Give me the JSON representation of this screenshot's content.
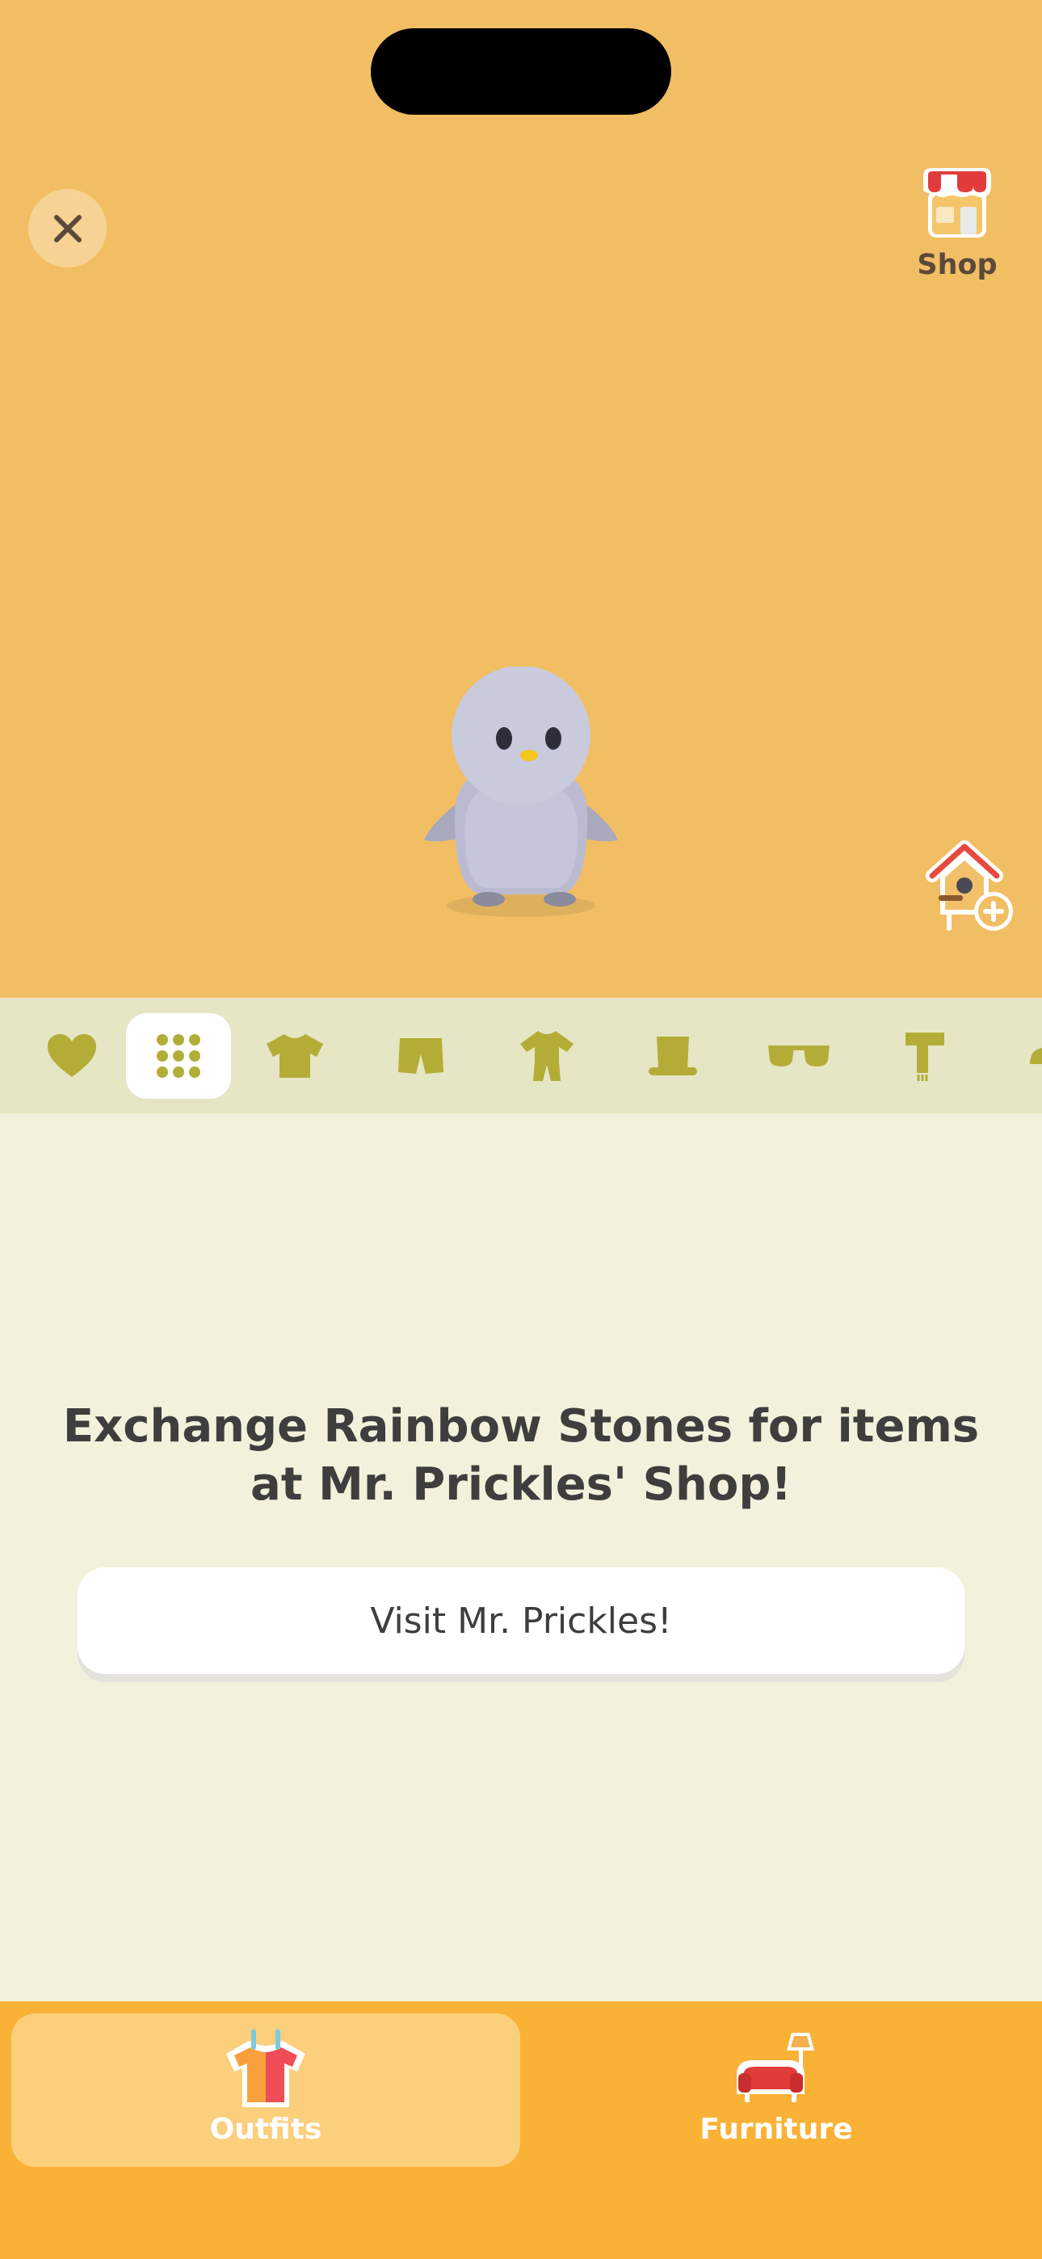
{
  "scene": {
    "background": "#f2be63",
    "close_icon": "close-icon",
    "shop_label": "Shop",
    "shop_icon": "shop-icon",
    "add_home_icon": "birdhouse-add-icon"
  },
  "categories": {
    "active": "all",
    "items": [
      {
        "id": "favorites",
        "icon": "heart-icon"
      },
      {
        "id": "all",
        "icon": "grid-icon"
      },
      {
        "id": "tops",
        "icon": "shirt-icon"
      },
      {
        "id": "bottoms",
        "icon": "shorts-icon"
      },
      {
        "id": "onesies",
        "icon": "onesie-icon"
      },
      {
        "id": "hats",
        "icon": "top-hat-icon"
      },
      {
        "id": "glasses",
        "icon": "sunglasses-icon"
      },
      {
        "id": "scarves",
        "icon": "scarf-icon"
      }
    ],
    "icon_color": "#b3ad38"
  },
  "content": {
    "headline": "Exchange Rainbow Stones for items at Mr. Prickles' Shop!",
    "visit_button": "Visit Mr. Prickles!"
  },
  "tabs": [
    {
      "label": "Outfits",
      "icon": "outfits-icon",
      "active": true
    },
    {
      "label": "Furniture",
      "icon": "sofa-lamp-icon",
      "active": false
    }
  ]
}
